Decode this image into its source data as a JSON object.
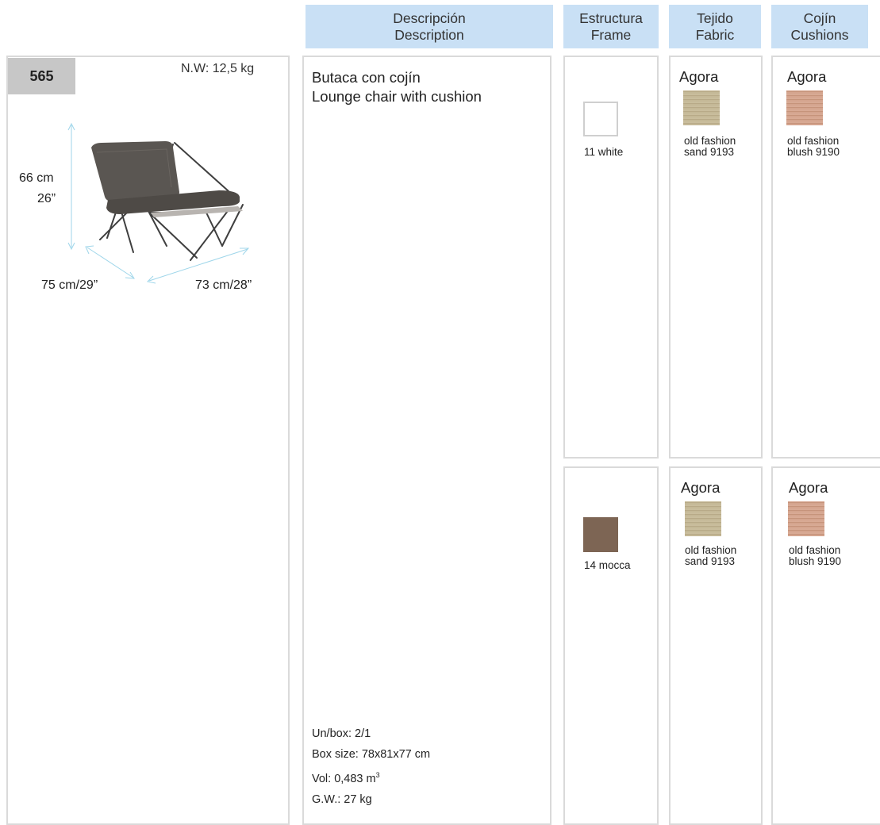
{
  "headers": {
    "description": [
      "Descripción",
      "Description"
    ],
    "frame": [
      "Estructura",
      "Frame"
    ],
    "fabric": [
      "Tejido",
      "Fabric"
    ],
    "cushions": [
      "Cojín",
      "Cushions"
    ]
  },
  "product": {
    "number": "565",
    "net_weight": "N.W: 12,5 kg",
    "dimensions": {
      "height_cm": "66 cm",
      "height_in": "26”",
      "width": "75 cm/29”",
      "depth": "73 cm/28”"
    },
    "image_icon": "lounge-chair-image"
  },
  "description": {
    "line_es": "Butaca con cojín",
    "line_en": "Lounge chair with cushion"
  },
  "packaging": {
    "units": "Un/box: 2/1",
    "box_size": "Box size: 78x81x77 cm",
    "vol": "Vol: 0,483 m",
    "vol_sup": "3",
    "gross_weight": "G.W.: 27 kg"
  },
  "variants": [
    {
      "frame_label": "11 white",
      "frame_color": "#ffffff",
      "fabric": {
        "name": "Agora",
        "line1": "old fashion",
        "line2": "sand 9193",
        "color": "#ddd5c0"
      },
      "cushion": {
        "name": "Agora",
        "line1": "old fashion",
        "line2": "blush 9190",
        "color": "#e5c8b9"
      }
    },
    {
      "frame_label": "14 mocca",
      "frame_color": "#7d6554",
      "fabric": {
        "name": "Agora",
        "line1": "old fashion",
        "line2": "sand 9193",
        "color": "#ddd5c0"
      },
      "cushion": {
        "name": "Agora",
        "line1": "old fashion",
        "line2": "blush 9190",
        "color": "#e5c8b9"
      }
    }
  ]
}
